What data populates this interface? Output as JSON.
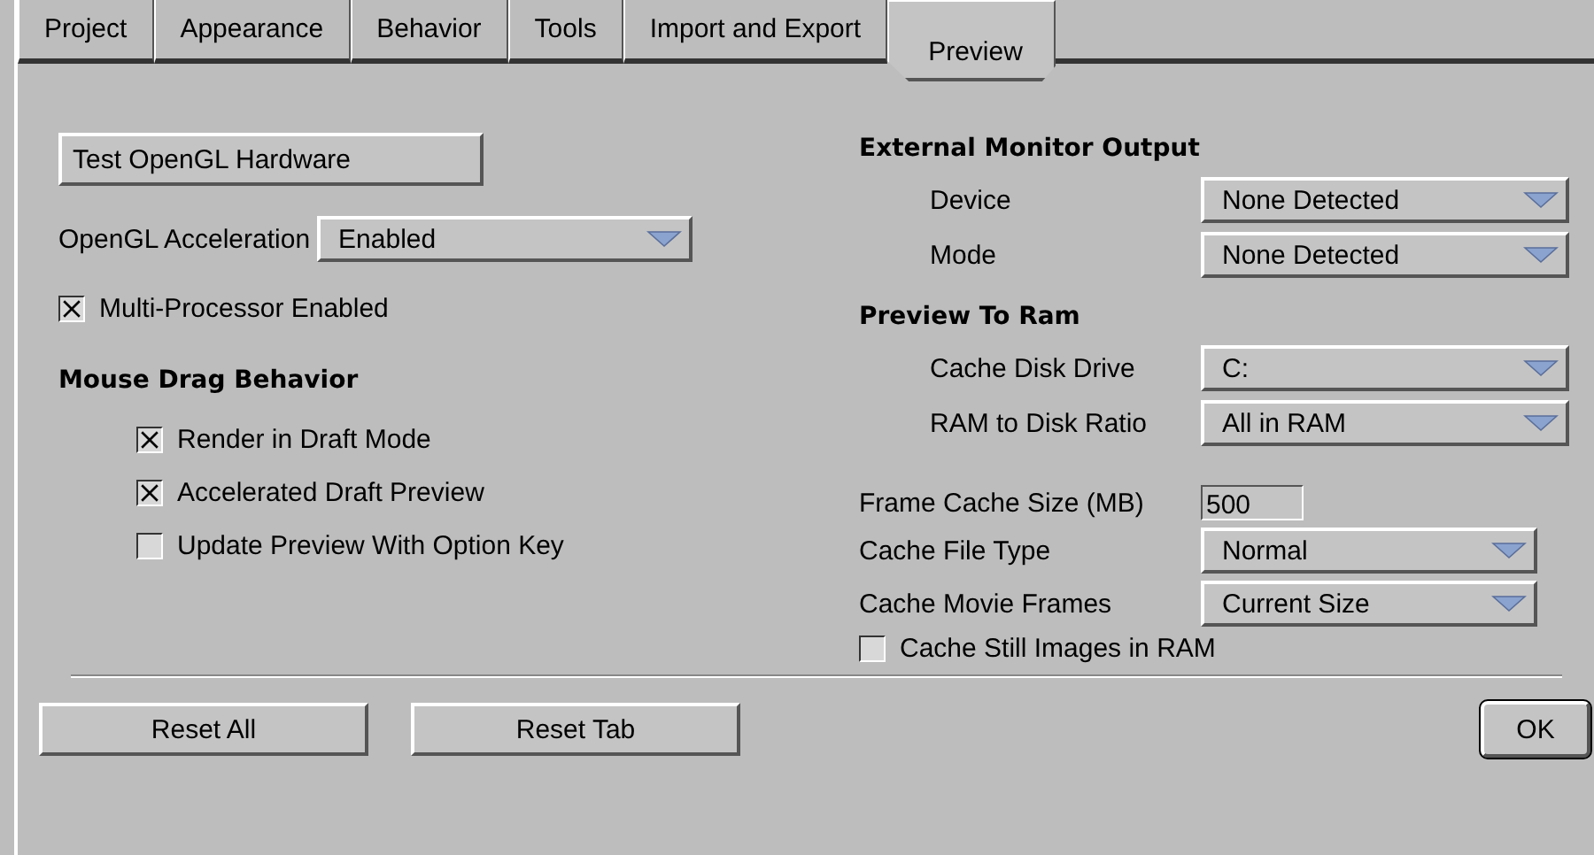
{
  "tabs": [
    {
      "label": "Project",
      "selected": false
    },
    {
      "label": "Appearance",
      "selected": false
    },
    {
      "label": "Behavior",
      "selected": false
    },
    {
      "label": "Tools",
      "selected": false
    },
    {
      "label": "Import and Export",
      "selected": false
    },
    {
      "label": "Preview",
      "selected": true
    }
  ],
  "left": {
    "test_button": "Test OpenGL Hardware",
    "opengl_acceleration": {
      "label": "OpenGL Acceleration",
      "value": "Enabled"
    },
    "multi_processor": {
      "label": "Multi-Processor Enabled",
      "checked": true
    },
    "mouse_drag": {
      "heading": "Mouse Drag Behavior",
      "options": [
        {
          "label": "Render in Draft Mode",
          "checked": true
        },
        {
          "label": "Accelerated Draft Preview",
          "checked": true
        },
        {
          "label": "Update Preview With Option Key",
          "checked": false
        }
      ]
    }
  },
  "right": {
    "external_monitor": {
      "heading": "External Monitor Output",
      "rows": [
        {
          "label": "Device",
          "value": "None Detected"
        },
        {
          "label": "Mode",
          "value": "None Detected"
        }
      ]
    },
    "preview_to_ram": {
      "heading": "Preview To Ram",
      "rows": [
        {
          "label": "Cache Disk Drive",
          "value": "C:"
        },
        {
          "label": "RAM to Disk Ratio",
          "value": "All in RAM"
        }
      ]
    },
    "frame_cache_size": {
      "label": "Frame Cache Size (MB)",
      "value": "500"
    },
    "cache_rows": [
      {
        "label": "Cache File Type",
        "value": "Normal"
      },
      {
        "label": "Cache Movie Frames",
        "value": "Current Size"
      }
    ],
    "cache_still_images": {
      "label": "Cache Still Images in RAM",
      "checked": false
    }
  },
  "buttons": [
    {
      "label": "Reset All",
      "kind": "plain"
    },
    {
      "label": "Reset Tab",
      "kind": "plain"
    },
    {
      "label": "OK",
      "kind": "default"
    }
  ]
}
